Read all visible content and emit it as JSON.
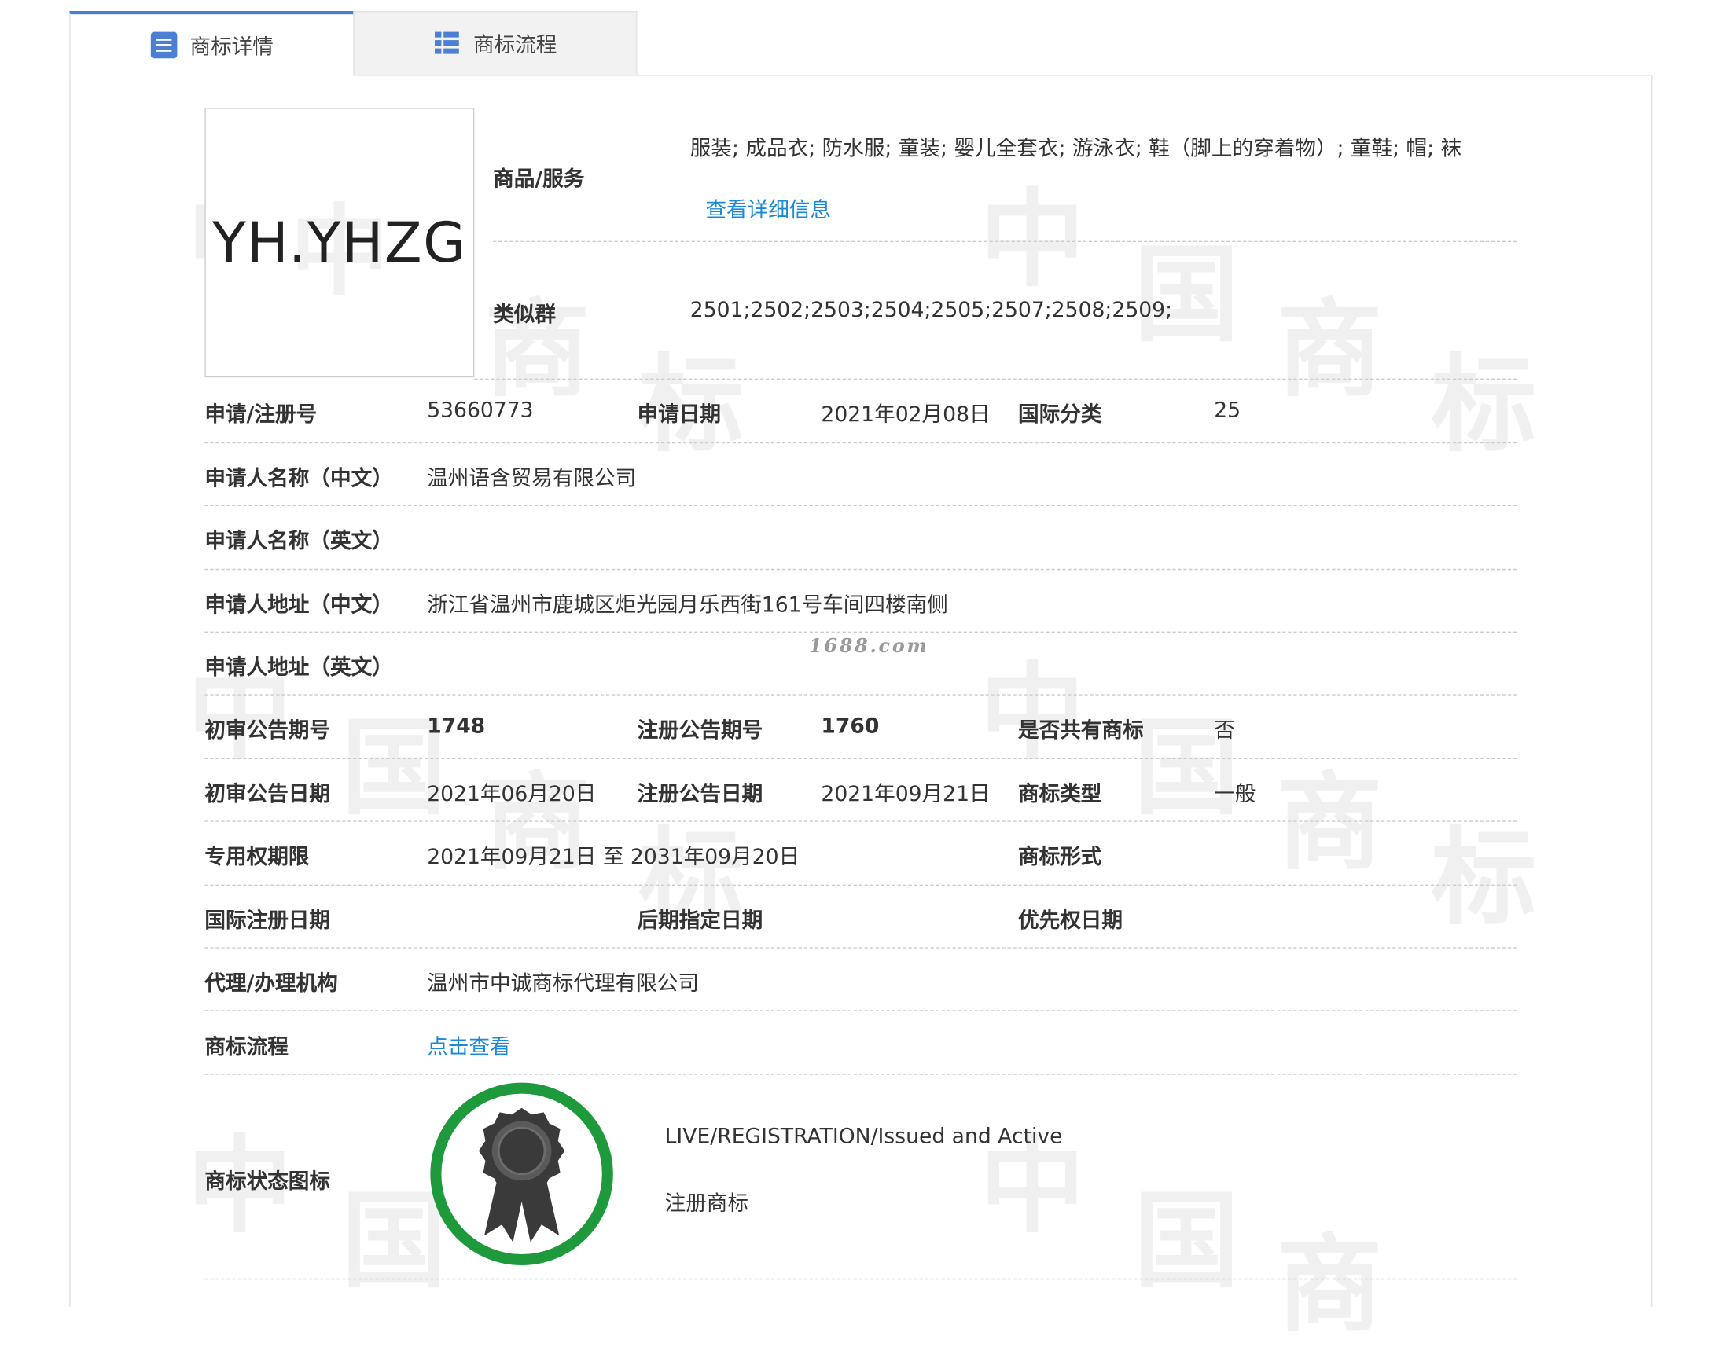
{
  "tabs": [
    {
      "label": "商标详情",
      "active": true,
      "icon": "list-icon"
    },
    {
      "label": "商标流程",
      "active": false,
      "icon": "grid-list-icon"
    }
  ],
  "watermark": {
    "site": "1688.com"
  },
  "trademark": {
    "logo_text": "YH.YHZG",
    "goods_services": {
      "label": "商品/服务",
      "value": "服装; 成品衣; 防水服; 童装; 婴儿全套衣; 游泳衣; 鞋（脚上的穿着物）; 童鞋; 帽; 袜",
      "detail_link": "查看详细信息"
    },
    "similar_group": {
      "label": "类似群",
      "value": "2501;2502;2503;2504;2505;2507;2508;2509;"
    },
    "reg_no": {
      "label": "申请/注册号",
      "value": "53660773"
    },
    "apply_date": {
      "label": "申请日期",
      "value": "2021年02月08日"
    },
    "intl_class": {
      "label": "国际分类",
      "value": "25"
    },
    "applicant_cn": {
      "label": "申请人名称（中文）",
      "value": "温州语含贸易有限公司"
    },
    "applicant_en": {
      "label": "申请人名称（英文）",
      "value": ""
    },
    "address_cn": {
      "label": "申请人地址（中文）",
      "value": "浙江省温州市鹿城区炬光园月乐西街161号车间四楼南侧"
    },
    "address_en": {
      "label": "申请人地址（英文）",
      "value": ""
    },
    "prelim_issue": {
      "label": "初审公告期号",
      "value": "1748"
    },
    "reg_issue": {
      "label": "注册公告期号",
      "value": "1760"
    },
    "shared": {
      "label": "是否共有商标",
      "value": "否"
    },
    "prelim_date": {
      "label": "初审公告日期",
      "value": "2021年06月20日"
    },
    "reg_date": {
      "label": "注册公告日期",
      "value": "2021年09月21日"
    },
    "tm_type": {
      "label": "商标类型",
      "value": "一般"
    },
    "exclusive_period": {
      "label": "专用权期限",
      "value": "2021年09月21日 至 2031年09月20日"
    },
    "tm_form": {
      "label": "商标形式",
      "value": ""
    },
    "intl_reg_date": {
      "label": "国际注册日期",
      "value": ""
    },
    "later_designation": {
      "label": "后期指定日期",
      "value": ""
    },
    "priority_date": {
      "label": "优先权日期",
      "value": ""
    },
    "agent": {
      "label": "代理/办理机构",
      "value": "温州市中诚商标代理有限公司"
    },
    "process": {
      "label": "商标流程",
      "link": "点击查看"
    },
    "status": {
      "label": "商标状态图标",
      "line1": "LIVE/REGISTRATION/Issued and Active",
      "line2": "注册商标",
      "badge_icon": "award-ribbon-icon",
      "ring_color": "#1e9a3c",
      "badge_color": "#3a3a3a"
    }
  },
  "colors": {
    "accent": "#4a7fd1",
    "link": "#1a8ad6"
  }
}
